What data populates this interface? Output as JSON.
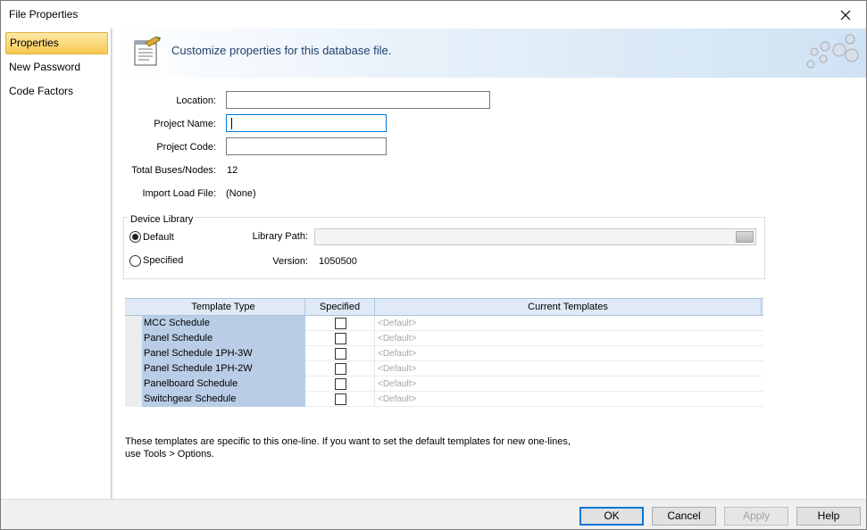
{
  "window": {
    "title": "File Properties",
    "close_icon": "close-icon"
  },
  "sidebar": {
    "items": [
      {
        "label": "Properties",
        "active": true
      },
      {
        "label": "New Password",
        "active": false
      },
      {
        "label": "Code Factors",
        "active": false
      }
    ]
  },
  "banner": {
    "text": "Customize properties for this database file.",
    "icon": "document-properties-icon"
  },
  "form": {
    "location": {
      "label": "Location:",
      "value": ""
    },
    "project_name": {
      "label": "Project Name:",
      "value": ""
    },
    "project_code": {
      "label": "Project Code:",
      "value": ""
    },
    "total_buses": {
      "label": "Total Buses/Nodes:",
      "value": "12"
    },
    "import_load": {
      "label": "Import Load File:",
      "value": "(None)"
    }
  },
  "device_library": {
    "title": "Device Library",
    "default_label": "Default",
    "specified_label": "Specified",
    "selected": "Default",
    "library_path_label": "Library Path:",
    "library_path_value": "",
    "version_label": "Version:",
    "version_value": "1050500"
  },
  "templates": {
    "columns": [
      "Template Type",
      "Specified",
      "Current Templates"
    ],
    "rows": [
      {
        "type": "MCC Schedule",
        "specified": false,
        "current": "<Default>"
      },
      {
        "type": "Panel Schedule",
        "specified": false,
        "current": "<Default>"
      },
      {
        "type": "Panel Schedule 1PH-3W",
        "specified": false,
        "current": "<Default>"
      },
      {
        "type": "Panel Schedule 1PH-2W",
        "specified": false,
        "current": "<Default>"
      },
      {
        "type": "Panelboard Schedule",
        "specified": false,
        "current": "<Default>"
      },
      {
        "type": "Switchgear Schedule",
        "specified": false,
        "current": "<Default>"
      }
    ]
  },
  "note": {
    "line1": "These templates are specific to this one-line. If you want to set the default templates for new one-lines,",
    "line2": "use Tools > Options."
  },
  "buttons": {
    "ok": "OK",
    "cancel": "Cancel",
    "apply": "Apply",
    "help": "Help"
  }
}
